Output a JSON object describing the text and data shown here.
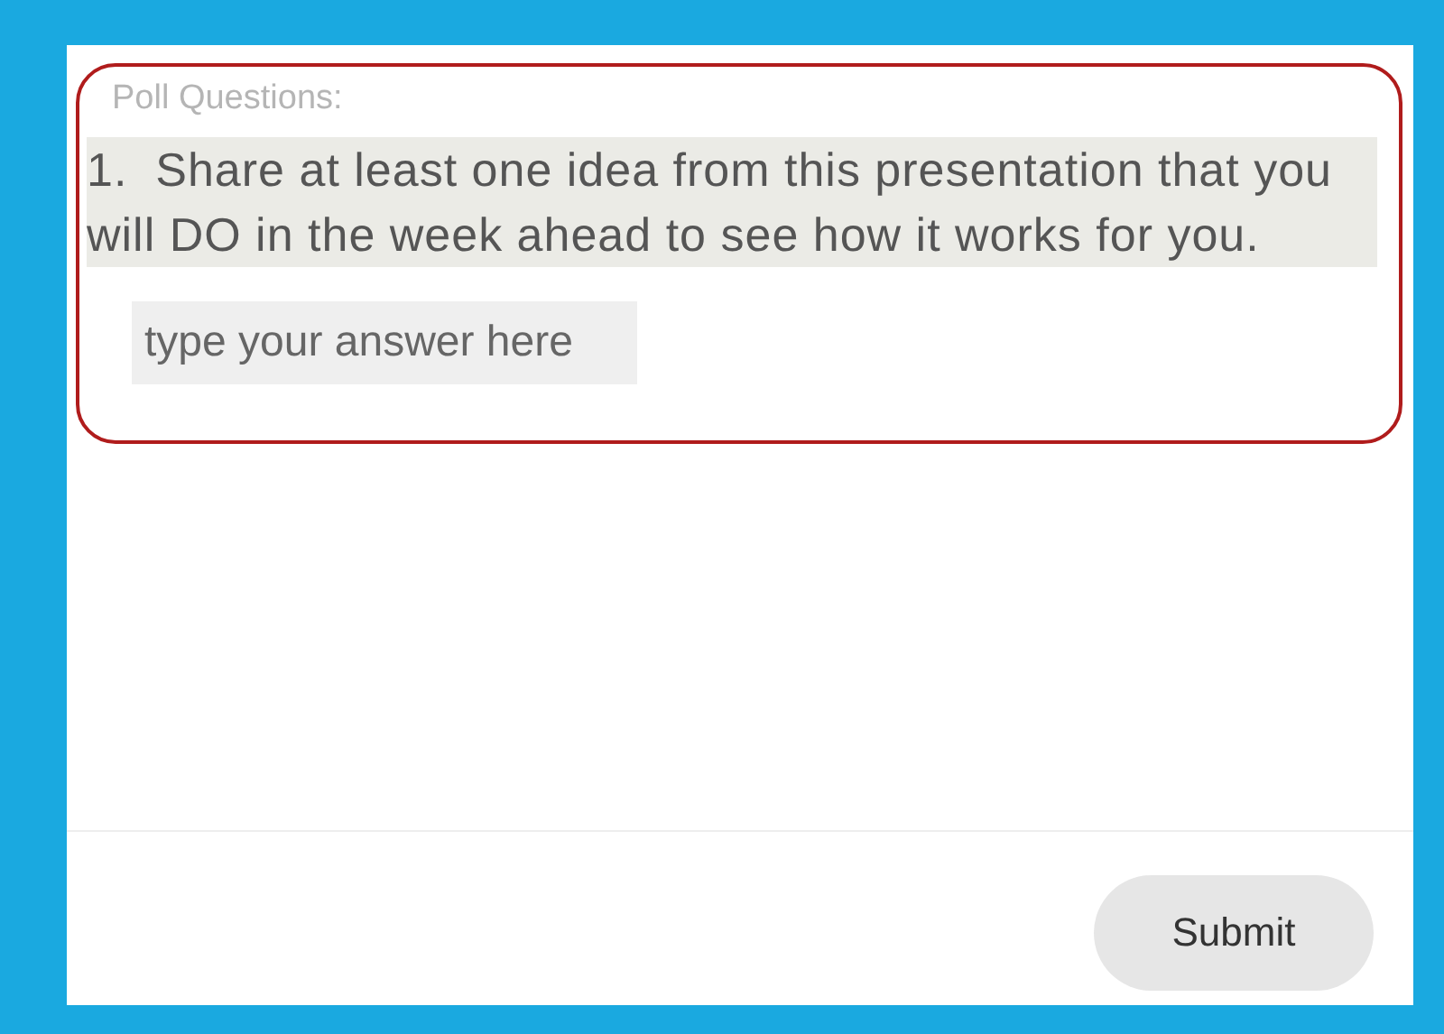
{
  "poll": {
    "heading": "Poll Questions:",
    "question": "1.  Share at least one idea from this presentation that you will DO in the week ahead to see how it works for you.",
    "answer": {
      "placeholder": "type your answer here"
    }
  },
  "buttons": [
    "Submit"
  ]
}
